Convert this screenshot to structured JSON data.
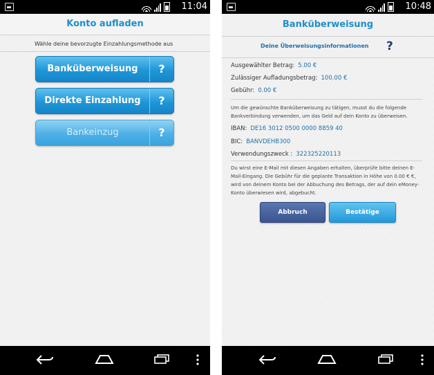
{
  "left": {
    "status_time": "11:04",
    "title": "Konto aufladen",
    "subtitle": "Wähle deine bevorzugte Einzahlungsmethode aus",
    "methods": [
      {
        "label": "Banküberweisung",
        "help": "?"
      },
      {
        "label": "Direkte Einzahlung",
        "help": "?"
      },
      {
        "label": "Bankeinzug",
        "help": "?"
      }
    ]
  },
  "right": {
    "status_time": "10:48",
    "title": "Banküberweisung",
    "info_header": "Deine Überweisungsinformationen",
    "help": "?",
    "selected_amount_label": "Ausgewählter Betrag:",
    "selected_amount_value": "5.00 €",
    "max_amount_label": "Zulässiger Aufladungsbetrag:",
    "max_amount_value": "100.00 €",
    "fee_label": "Gebühr:",
    "fee_value": "0.00 €",
    "instruction": "Um die gewünschte Banküberweisung zu tätigen, musst du die folgende Bankverbindung verwenden, um das Geld auf dein Konto zu überweisen.",
    "iban_label": "IBAN:",
    "iban_value": "DE16 3012 0500 0000 8859 40",
    "bic_label": "BIC:",
    "bic_value": "BANVDEHB300",
    "purpose_label": "Verwendungszweck :",
    "purpose_value": "322325220113",
    "email_note": "Du wirst eine E-Mail mit diesen Angaben erhalten, überprüfe bitte deinen E-Mail-Eingang. Die Gebühr für die geplante Transaktion in Höhe von 0.00 €  €, wird von deinem Konto bei der Abbuchung des Betrags, der auf dein eMoney-Konto überwiesen wird, abgebucht.",
    "cancel_label": "Abbruch",
    "confirm_label": "Bestätige"
  },
  "colors": {
    "accent": "#1f8fc8",
    "button_blue": "#1f96d8",
    "button_dark": "#3a5490"
  },
  "icons": [
    "notification-icon",
    "wifi-icon",
    "signal-icon",
    "battery-icon",
    "back-icon",
    "home-icon",
    "recent-apps-icon",
    "menu-icon"
  ]
}
